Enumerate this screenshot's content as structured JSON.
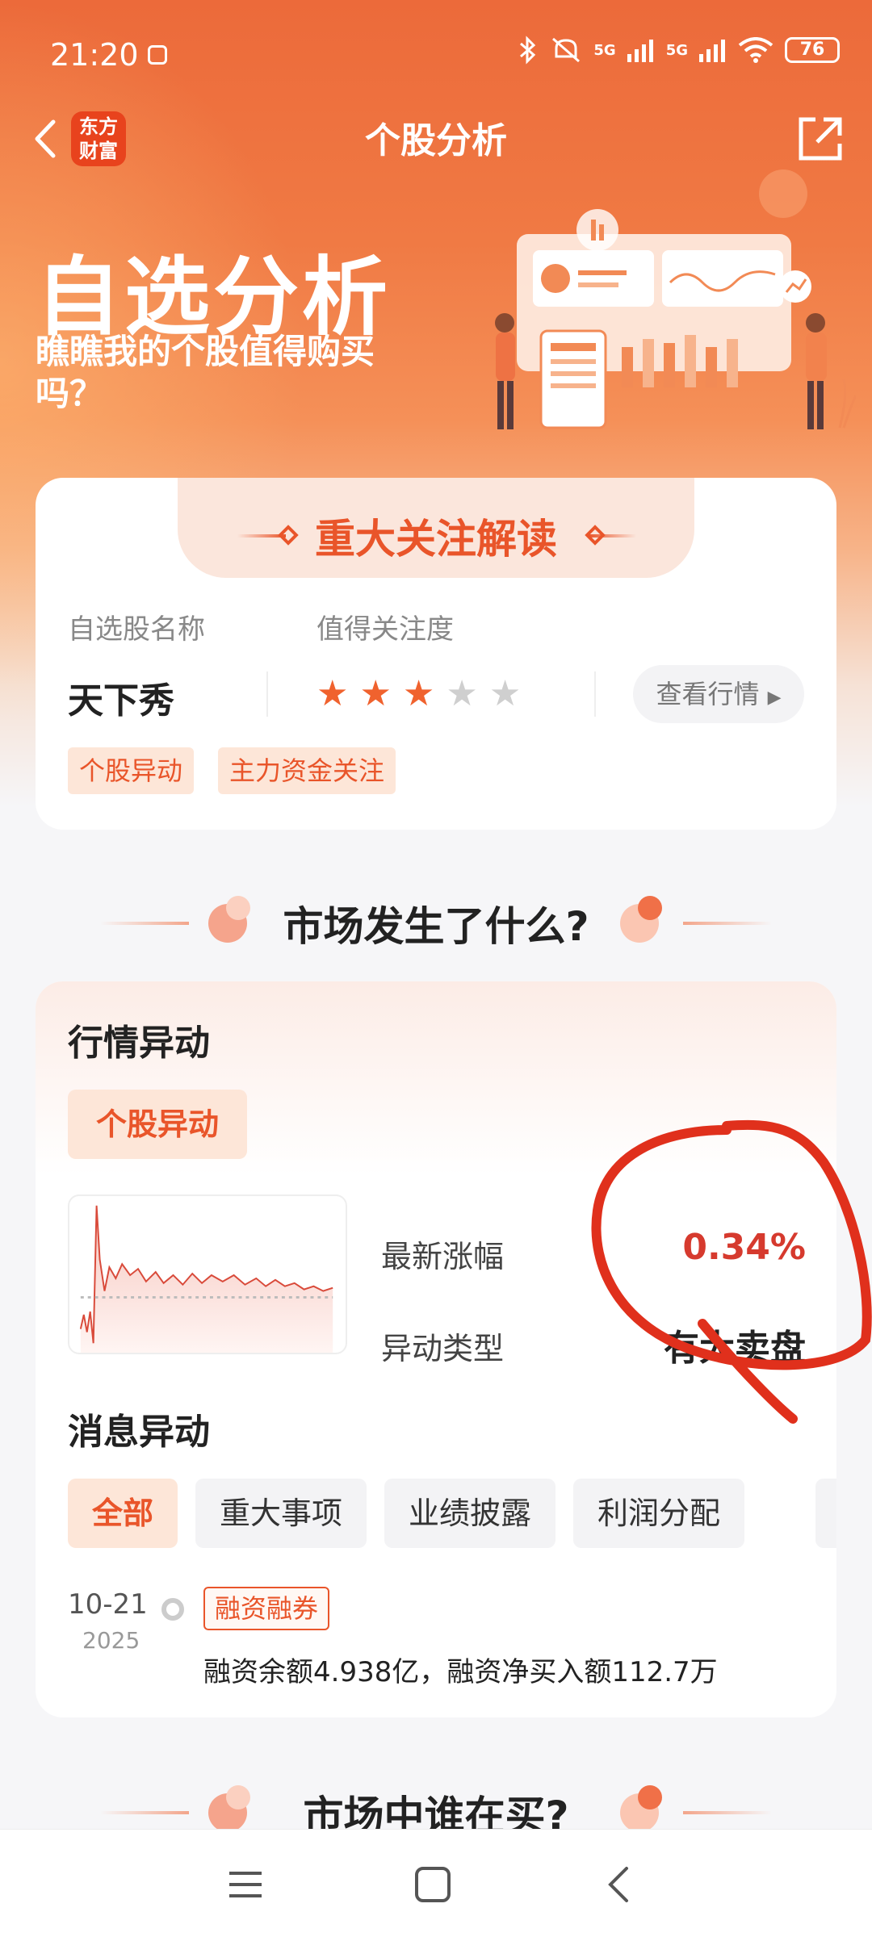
{
  "status_bar": {
    "time": "21:20",
    "network_1": "5G",
    "network_2": "5G",
    "battery": "76"
  },
  "nav": {
    "title": "个股分析",
    "logo_line1": "东方",
    "logo_line2": "财富"
  },
  "banner": {
    "title": "自选分析",
    "subtitle": "瞧瞧我的个股值得购买吗？"
  },
  "focus_card": {
    "title": "重大关注解读",
    "name_label": "自选股名称",
    "attention_label": "值得关注度",
    "stock_name": "天下秀",
    "rating": 3,
    "rating_max": 5,
    "view_button": "查看行情",
    "tags": [
      "个股异动",
      "主力资金关注"
    ]
  },
  "section_market": {
    "title": "市场发生了什么?"
  },
  "market_card": {
    "title": "行情异动",
    "type_pill": "个股异动",
    "change_label": "最新涨幅",
    "change_value": "0.34%",
    "anomaly_label": "异动类型",
    "anomaly_value": "有大卖盘",
    "news_title": "消息异动",
    "filters": [
      "全部",
      "重大事项",
      "业绩披露",
      "利润分配"
    ],
    "news": [
      {
        "date": "10-21",
        "year": "2025",
        "tag": "融资融券",
        "text": "融资余额4.938亿，融资净买入额112.7万"
      }
    ]
  },
  "section_buyers": {
    "title": "市场中谁在买?"
  },
  "colors": {
    "accent": "#e9552a",
    "positive": "#d63a2e",
    "star_on": "#f0622e",
    "star_off": "#cfcfcf",
    "annotation": "#e0301c"
  }
}
